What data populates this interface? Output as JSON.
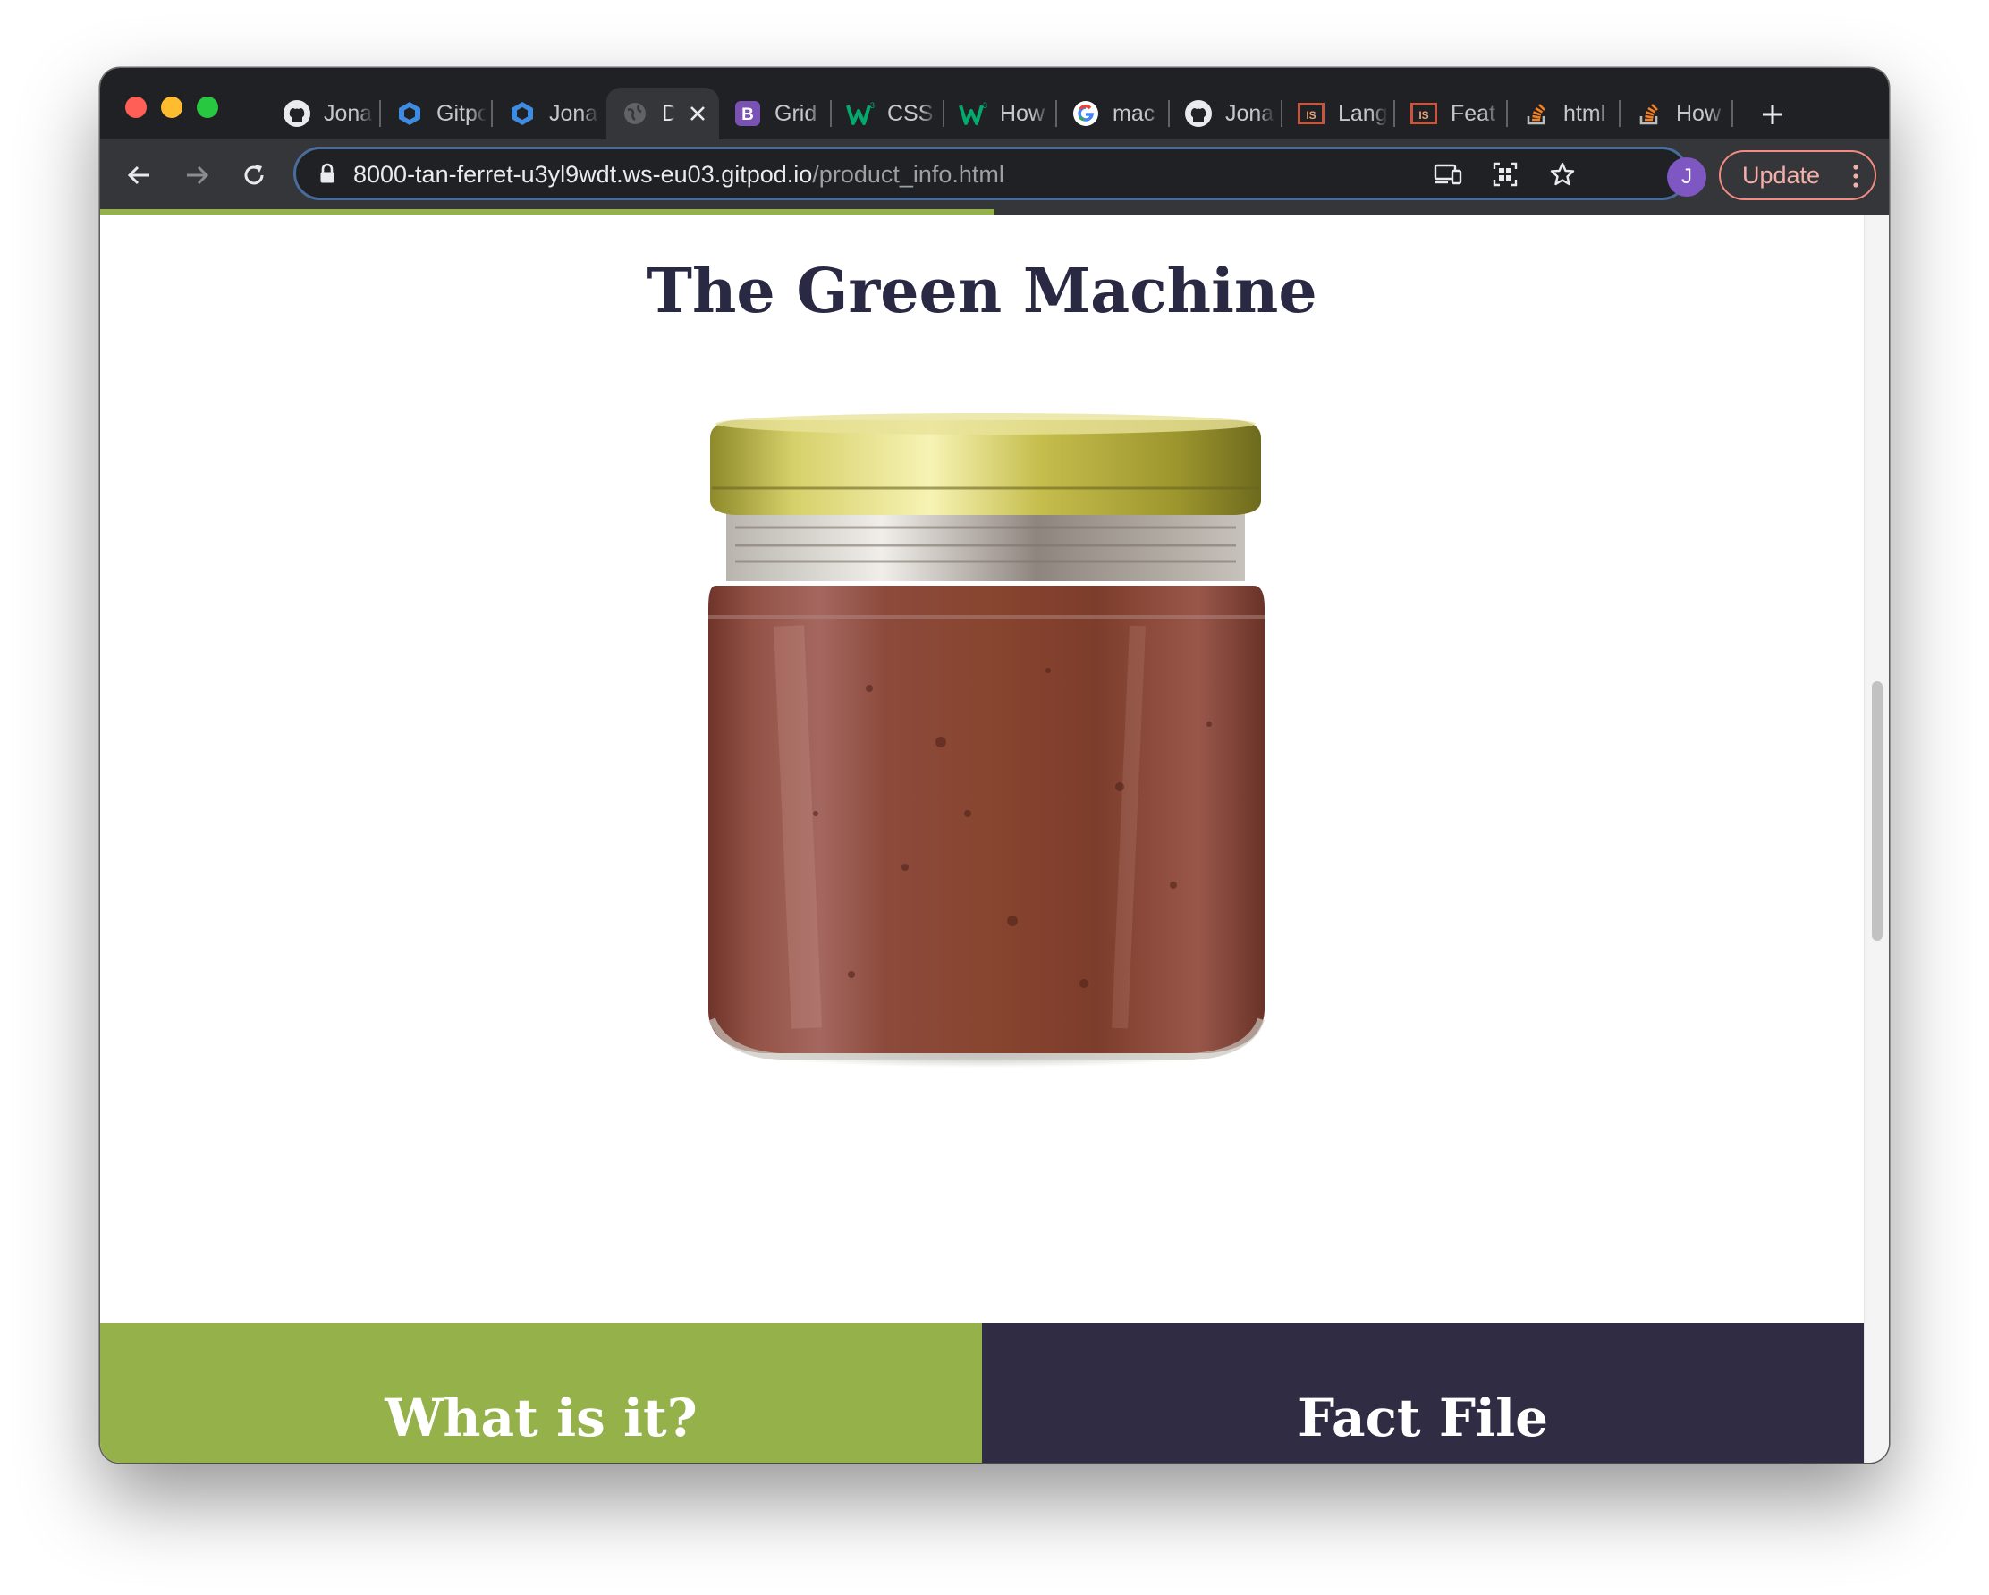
{
  "browser": {
    "tabs": [
      {
        "icon": "github-icon",
        "title": "Jonathan"
      },
      {
        "icon": "gitpod-icon",
        "title": "Gitpod"
      },
      {
        "icon": "gitpod-icon",
        "title": "Jonathan"
      },
      {
        "icon": "globe-icon",
        "title": "D",
        "active": true
      },
      {
        "icon": "bootstrap-icon",
        "title": "Grid"
      },
      {
        "icon": "w3schools-icon",
        "title": "CSS"
      },
      {
        "icon": "w3schools-icon",
        "title": "How"
      },
      {
        "icon": "google-icon",
        "title": "mac"
      },
      {
        "icon": "github-icon",
        "title": "Jonathan"
      },
      {
        "icon": "caniuse-icon",
        "title": "Lang"
      },
      {
        "icon": "caniuse-icon",
        "title": "Feat"
      },
      {
        "icon": "stackoverflow-icon",
        "title": "html"
      },
      {
        "icon": "stackoverflow-icon",
        "title": "How"
      }
    ],
    "url": {
      "host": "8000-tan-ferret-u3yl9wdt.ws-eu03.gitpod.io",
      "path": "/product_info.html"
    },
    "profile_initial": "J",
    "update_label": "Update",
    "load_progress": 0.5,
    "colors": {
      "accent_green": "#94b14a",
      "dark_navy": "#302c43",
      "update_red": "#f28b82"
    }
  },
  "page": {
    "title": "The Green Machine",
    "image_alt": "jar of brown spread with gold lid",
    "panels": [
      {
        "heading": "What is it?"
      },
      {
        "heading": "Fact File"
      }
    ]
  }
}
